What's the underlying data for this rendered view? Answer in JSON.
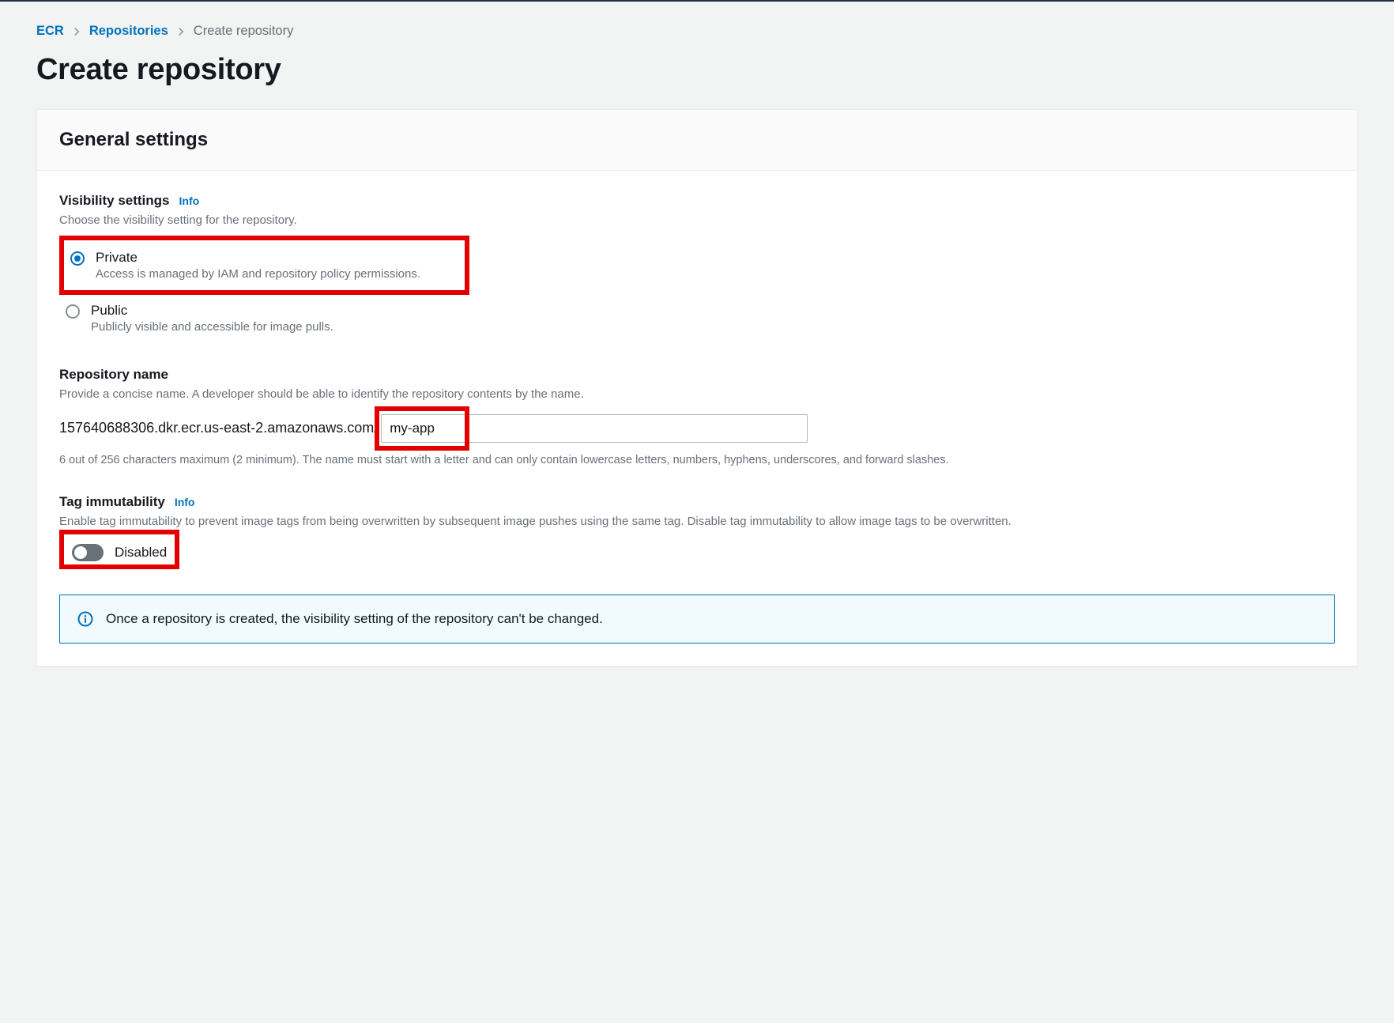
{
  "breadcrumb": {
    "level1": "ECR",
    "level2": "Repositories",
    "current": "Create repository"
  },
  "page_title": "Create repository",
  "panel": {
    "header": "General settings",
    "visibility": {
      "label": "Visibility settings",
      "info": "Info",
      "desc": "Choose the visibility setting for the repository.",
      "options": [
        {
          "title": "Private",
          "sub": "Access is managed by IAM and repository policy permissions.",
          "selected": true
        },
        {
          "title": "Public",
          "sub": "Publicly visible and accessible for image pulls.",
          "selected": false
        }
      ]
    },
    "repo_name": {
      "label": "Repository name",
      "desc": "Provide a concise name. A developer should be able to identify the repository contents by the name.",
      "prefix": "157640688306.dkr.ecr.us-east-2.amazonaws.com/",
      "value": "my-app",
      "below": "6 out of 256 characters maximum (2 minimum). The name must start with a letter and can only contain lowercase letters, numbers, hyphens, underscores, and forward slashes."
    },
    "tag_immutability": {
      "label": "Tag immutability",
      "info": "Info",
      "desc": "Enable tag immutability to prevent image tags from being overwritten by subsequent image pushes using the same tag. Disable tag immutability to allow image tags to be overwritten.",
      "state_label": "Disabled"
    },
    "alert_text": "Once a repository is created, the visibility setting of the repository can't be changed."
  }
}
